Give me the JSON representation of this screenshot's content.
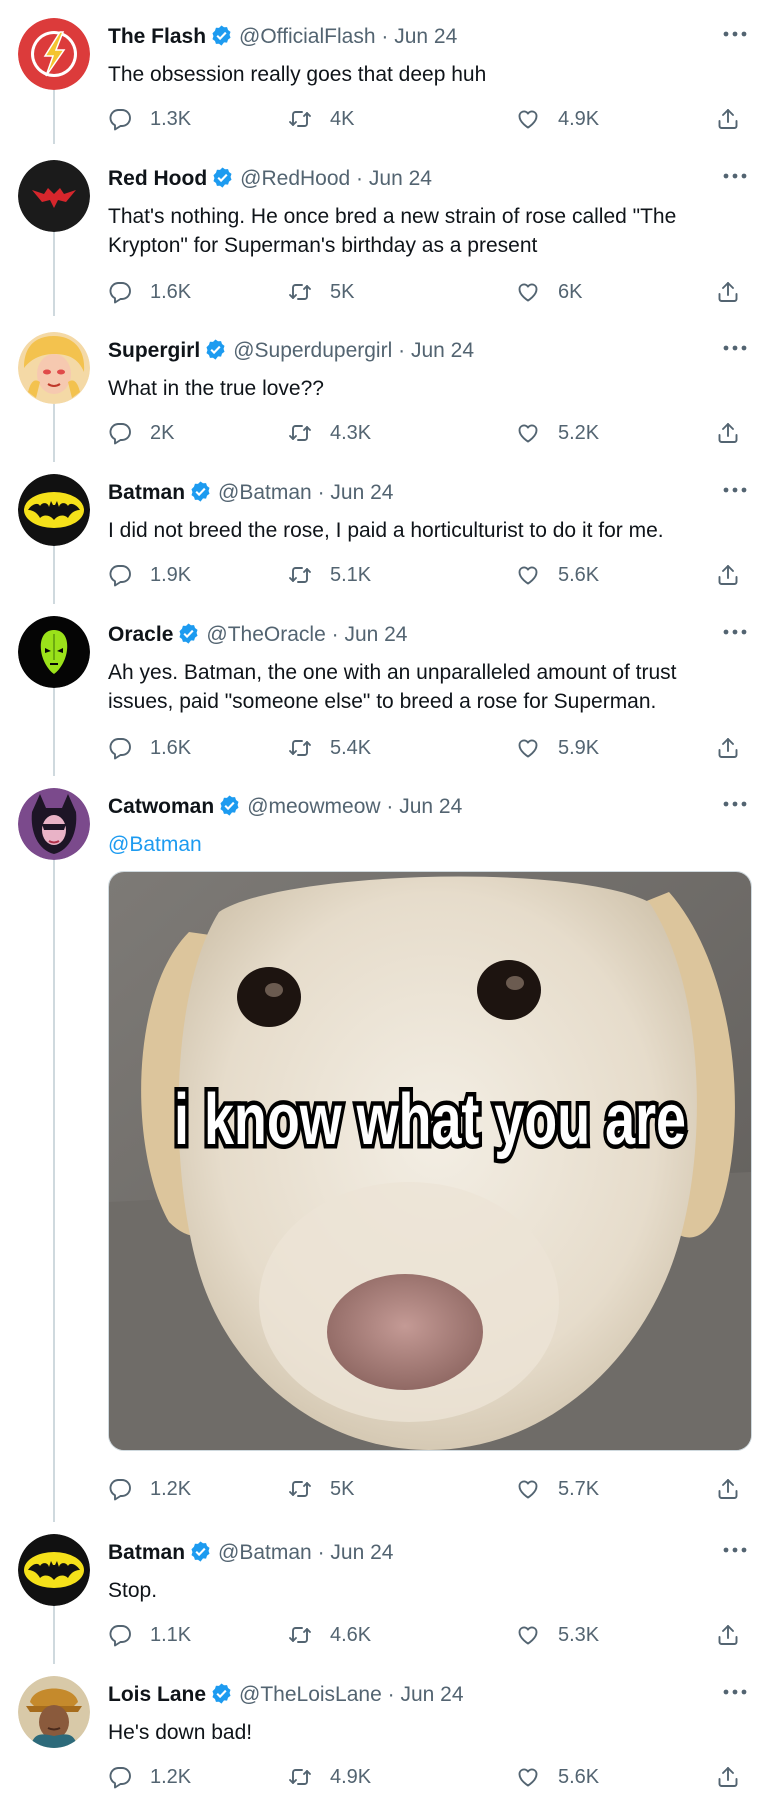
{
  "tweets": [
    {
      "name": "The Flash",
      "handle": "@OfficialFlash",
      "dot": "·",
      "date": "Jun 24",
      "lines": [
        "The obsession really goes that deep huh"
      ],
      "replies": "1.3K",
      "retweets": "4K",
      "likes": "4.9K",
      "avatar": "flash-logo"
    },
    {
      "name": "Red Hood",
      "handle": "@RedHood",
      "dot": "·",
      "date": "Jun 24",
      "lines": [
        "That's nothing. He once bred a new strain of rose called \"The",
        "Krypton\" for Superman's birthday as a present"
      ],
      "replies": "1.6K",
      "retweets": "5K",
      "likes": "6K",
      "avatar": "red-hood-logo"
    },
    {
      "name": "Supergirl",
      "handle": "@Superdupergirl",
      "dot": "·",
      "date": "Jun 24",
      "lines": [
        "What in the true love??"
      ],
      "replies": "2K",
      "retweets": "4.3K",
      "likes": "5.2K",
      "avatar": "supergirl-portrait"
    },
    {
      "name": "Batman",
      "handle": "@Batman",
      "dot": "·",
      "date": "Jun 24",
      "lines": [
        "I did not breed the rose, I paid a horticulturist to do it for me."
      ],
      "replies": "1.9K",
      "retweets": "5.1K",
      "likes": "5.6K",
      "avatar": "bat-logo"
    },
    {
      "name": "Oracle",
      "handle": "@TheOracle",
      "dot": "·",
      "date": "Jun 24",
      "lines": [
        "Ah yes. Batman, the one with an unparalleled amount of trust",
        "issues, paid \"someone else\" to breed a rose for Superman."
      ],
      "replies": "1.6K",
      "retweets": "5.4K",
      "likes": "5.9K",
      "avatar": "oracle-mask"
    },
    {
      "name": "Catwoman",
      "handle": "@meowmeow",
      "dot": "·",
      "date": "Jun 24",
      "lines": [
        "@Batman"
      ],
      "replies": "1.2K",
      "retweets": "5K",
      "likes": "5.7K",
      "avatar": "catwoman-portrait",
      "media_caption": "i know what you are"
    },
    {
      "name": "Batman",
      "handle": "@Batman",
      "dot": "·",
      "date": "Jun 24",
      "lines": [
        "Stop."
      ],
      "replies": "1.1K",
      "retweets": "4.6K",
      "likes": "5.3K",
      "avatar": "bat-logo"
    },
    {
      "name": "Lois Lane",
      "handle": "@TheLoisLane",
      "dot": "·",
      "date": "Jun 24",
      "lines": [
        "He's down bad!"
      ],
      "replies": "1.2K",
      "retweets": "4.9K",
      "likes": "5.6K",
      "avatar": "lois-lane-portrait"
    }
  ],
  "colors": {
    "text": "#0f1419",
    "muted": "#536471",
    "verified": "#1d9bf0",
    "mention": "#1d9bf0",
    "thread_line": "#cfd9de"
  }
}
